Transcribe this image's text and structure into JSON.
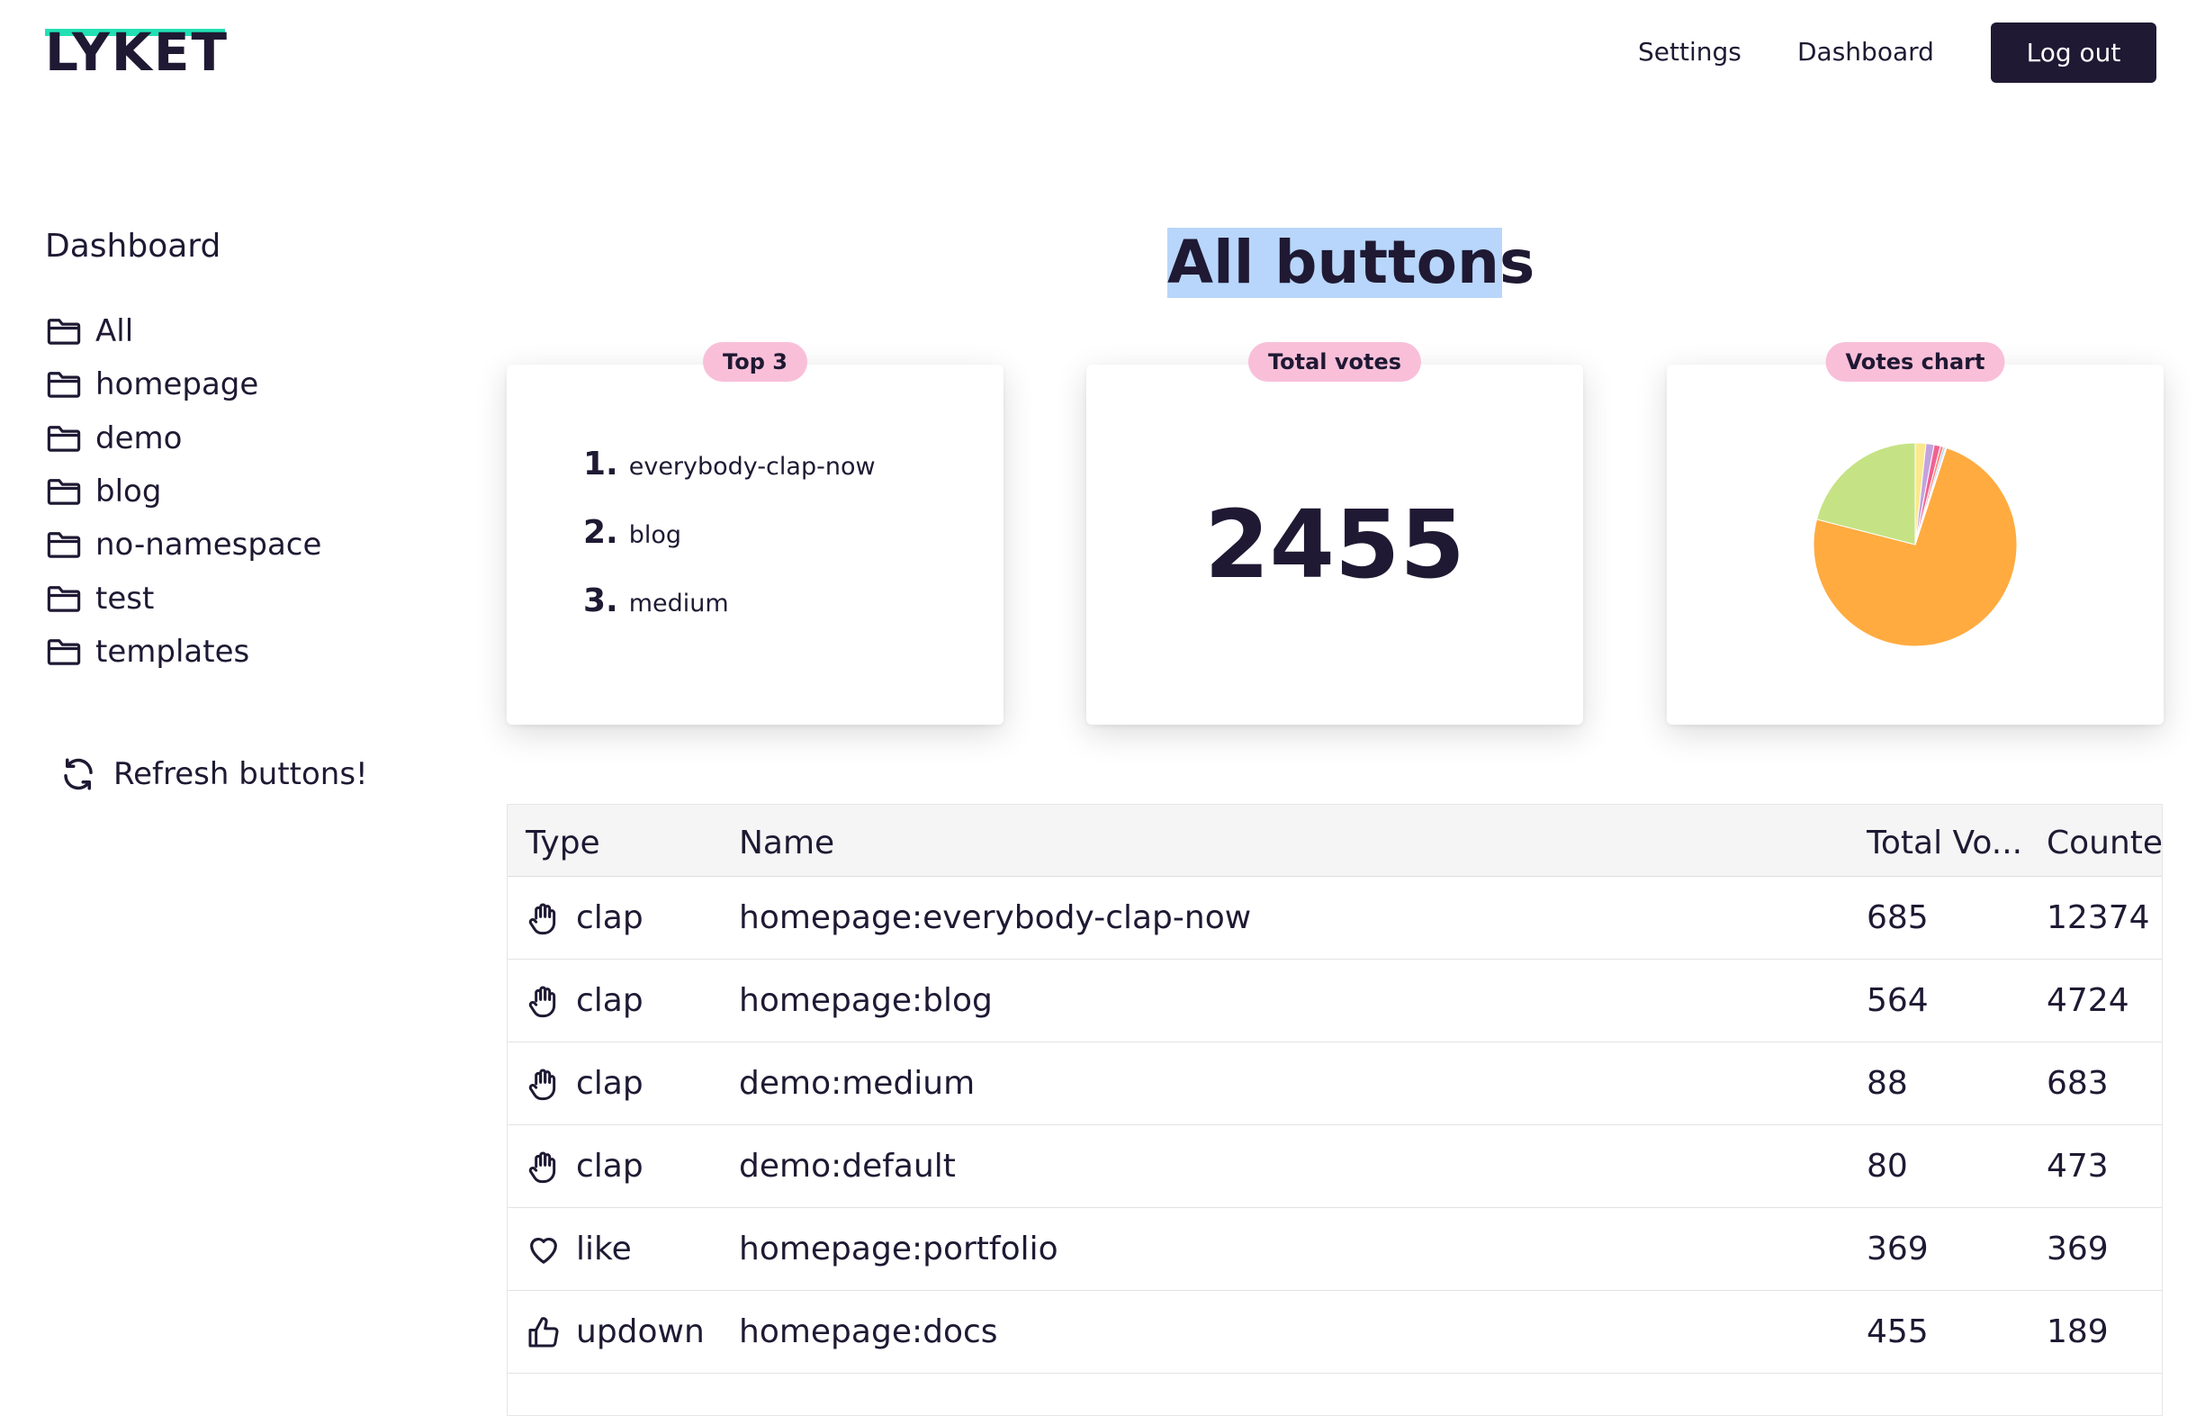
{
  "brand": {
    "name": "LYKET",
    "accent": "#22e0b4",
    "primary": "#1f1933"
  },
  "nav": {
    "settings": "Settings",
    "dashboard": "Dashboard",
    "logout": "Log out"
  },
  "sidebar": {
    "title": "Dashboard",
    "items": [
      {
        "label": "All",
        "icon": "folder-icon"
      },
      {
        "label": "homepage",
        "icon": "folder-icon"
      },
      {
        "label": "demo",
        "icon": "folder-icon"
      },
      {
        "label": "blog",
        "icon": "folder-icon"
      },
      {
        "label": "no-namespace",
        "icon": "folder-icon"
      },
      {
        "label": "test",
        "icon": "folder-icon"
      },
      {
        "label": "templates",
        "icon": "folder-icon"
      }
    ],
    "refresh": "Refresh buttons!"
  },
  "main": {
    "heading": "All buttons",
    "cards": {
      "top3": {
        "label": "Top 3",
        "items": [
          {
            "rank": "1.",
            "name": "everybody-clap-now"
          },
          {
            "rank": "2.",
            "name": "blog"
          },
          {
            "rank": "3.",
            "name": "medium"
          }
        ]
      },
      "total": {
        "label": "Total votes",
        "value": "2455"
      },
      "chart": {
        "label": "Votes chart"
      }
    }
  },
  "chart_data": {
    "type": "pie",
    "values": [
      74,
      21,
      1.7,
      1.3,
      1,
      0.5,
      0.3,
      0.2
    ],
    "colors": [
      "#ffab40",
      "#c5e384",
      "#fbe88c",
      "#c3a3dd",
      "#f06292",
      "#ff8a80",
      "#90caf9",
      "#f5d0e0"
    ]
  },
  "table": {
    "columns": [
      "Type",
      "Name",
      "Total Vo...",
      "Counte"
    ],
    "rows": [
      {
        "type": "clap",
        "icon": "clap-hand-icon",
        "name": "homepage:everybody-clap-now",
        "total": "685",
        "count": "12374"
      },
      {
        "type": "clap",
        "icon": "clap-hand-icon",
        "name": "homepage:blog",
        "total": "564",
        "count": "4724"
      },
      {
        "type": "clap",
        "icon": "clap-hand-icon",
        "name": "demo:medium",
        "total": "88",
        "count": "683"
      },
      {
        "type": "clap",
        "icon": "clap-hand-icon",
        "name": "demo:default",
        "total": "80",
        "count": "473"
      },
      {
        "type": "like",
        "icon": "heart-icon",
        "name": "homepage:portfolio",
        "total": "369",
        "count": "369"
      },
      {
        "type": "updown",
        "icon": "thumbs-up-icon",
        "name": "homepage:docs",
        "total": "455",
        "count": "189"
      }
    ]
  }
}
